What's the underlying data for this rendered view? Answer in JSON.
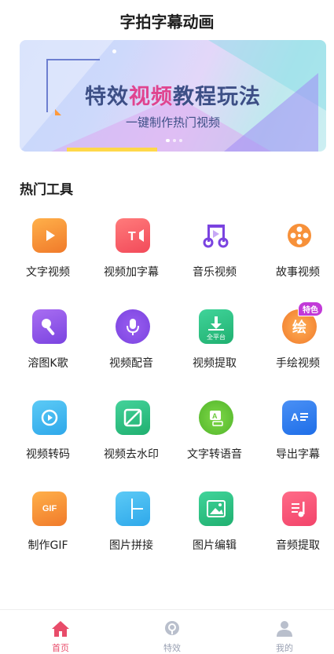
{
  "header": {
    "title": "字拍字幕动画"
  },
  "banner": {
    "headline_pre": "特效",
    "headline_highlight": "视频",
    "headline_post": "教程玩法",
    "subline": "一键制作热门视频",
    "page_count": 3,
    "active_page": 1
  },
  "section": {
    "title": "热门工具"
  },
  "tools": [
    {
      "label": "文字视频",
      "icon": "play-icon",
      "color": "#f7913a"
    },
    {
      "label": "视频加字幕",
      "icon": "text-video-icon",
      "color": "#f25a5a"
    },
    {
      "label": "音乐视频",
      "icon": "music-note-icon",
      "color": "#7a43e0"
    },
    {
      "label": "故事视频",
      "icon": "film-reel-icon",
      "color": "#f7913a"
    },
    {
      "label": "溶图K歌",
      "icon": "microphone-icon",
      "color": "#8b4ce6"
    },
    {
      "label": "视频配音",
      "icon": "mic-icon",
      "color": "#8b4ce6"
    },
    {
      "label": "视频提取",
      "icon": "download-icon",
      "color": "#34c48a",
      "sublabel": "全平台"
    },
    {
      "label": "手绘视频",
      "icon": "paint-icon",
      "color": "#f7913a",
      "badge": "特色",
      "glyph": "绘"
    },
    {
      "label": "视频转码",
      "icon": "convert-icon",
      "color": "#3db6f0"
    },
    {
      "label": "视频去水印",
      "icon": "no-watermark-icon",
      "color": "#34c48a"
    },
    {
      "label": "文字转语音",
      "icon": "text-to-speech-icon",
      "color": "#6bc93d"
    },
    {
      "label": "导出字幕",
      "icon": "export-subtitle-icon",
      "color": "#2f7df0",
      "glyph": "A"
    },
    {
      "label": "制作GIF",
      "icon": "gif-icon",
      "color": "#f7913a",
      "glyph": "GIF"
    },
    {
      "label": "图片拼接",
      "icon": "grid-icon",
      "color": "#3db6f0"
    },
    {
      "label": "图片编辑",
      "icon": "image-icon",
      "color": "#34c48a"
    },
    {
      "label": "音频提取",
      "icon": "audio-extract-icon",
      "color": "#f25a7a"
    }
  ],
  "tabbar": [
    {
      "label": "首页",
      "icon": "home-icon",
      "active": true
    },
    {
      "label": "特效",
      "icon": "lightbulb-icon",
      "active": false
    },
    {
      "label": "我的",
      "icon": "user-icon",
      "active": false
    }
  ],
  "colors": {
    "accent": "#e84c6a",
    "inactive": "#9aa1b3"
  }
}
